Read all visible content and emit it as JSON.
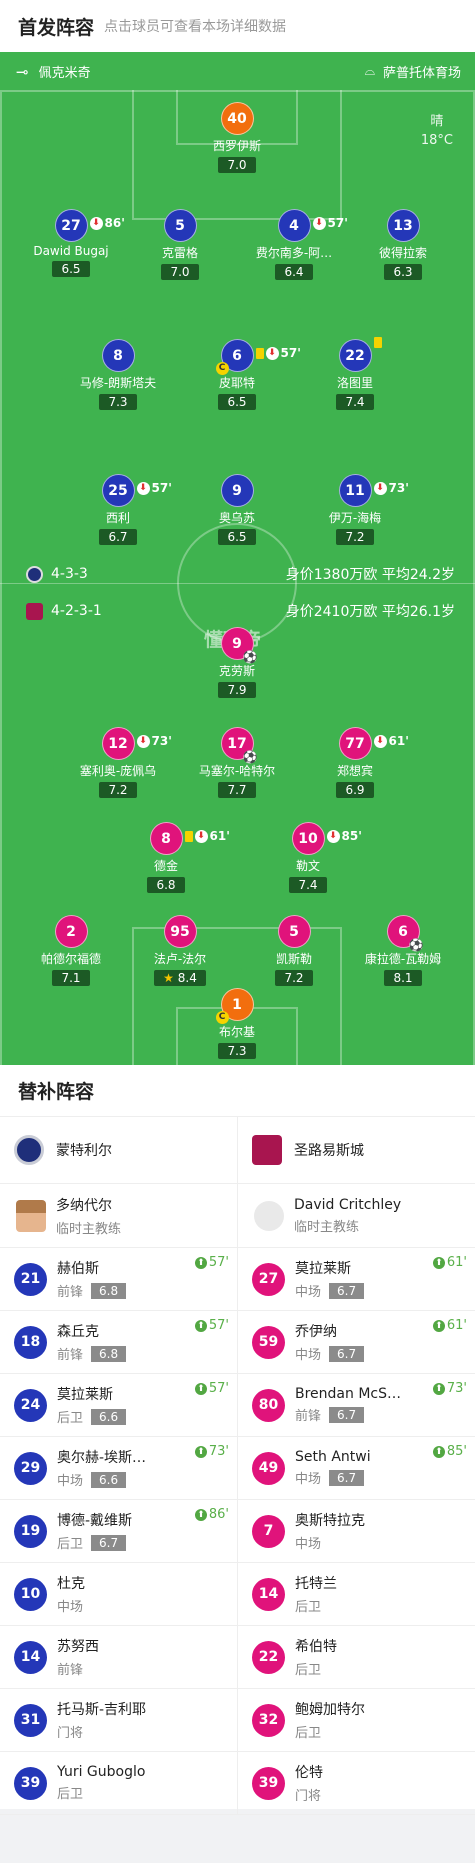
{
  "header": {
    "title": "首发阵容",
    "subtitle": "点击球员可查看本场详细数据"
  },
  "field": {
    "venue_left": "佩克米奇",
    "venue_right": "萨普托体育场",
    "weather": "晴",
    "temp": "18°C",
    "watermark": "懂球帝",
    "team_top": {
      "formation": "4-3-3",
      "value": "身价1380万欧 平均24.2岁"
    },
    "team_bottom": {
      "formation": "4-2-3-1",
      "value": "身价2410万欧 平均26.1岁"
    }
  },
  "top_players": [
    {
      "num": "40",
      "name": "西罗伊斯",
      "rating": "7.0"
    },
    {
      "num": "27",
      "name": "Dawid Bugaj",
      "rating": "6.5",
      "sub": "86'"
    },
    {
      "num": "5",
      "name": "克雷格",
      "rating": "7.0"
    },
    {
      "num": "4",
      "name": "费尔南多-阿…",
      "rating": "6.4",
      "sub": "57'"
    },
    {
      "num": "13",
      "name": "彼得拉索",
      "rating": "6.3"
    },
    {
      "num": "8",
      "name": "马修-朗斯塔夫",
      "rating": "7.3"
    },
    {
      "num": "6",
      "name": "皮耶特",
      "rating": "6.5",
      "sub": "57'"
    },
    {
      "num": "22",
      "name": "洛图里",
      "rating": "7.4"
    },
    {
      "num": "25",
      "name": "西利",
      "rating": "6.7",
      "sub": "57'"
    },
    {
      "num": "9",
      "name": "奥乌苏",
      "rating": "6.5"
    },
    {
      "num": "11",
      "name": "伊万-海梅",
      "rating": "7.2",
      "sub": "73'"
    }
  ],
  "bottom_players": [
    {
      "num": "9",
      "name": "克劳斯",
      "rating": "7.9"
    },
    {
      "num": "12",
      "name": "塞利奥-庞佩乌",
      "rating": "7.2",
      "sub": "73'"
    },
    {
      "num": "17",
      "name": "马塞尔-哈特尔",
      "rating": "7.7"
    },
    {
      "num": "77",
      "name": "郑想宾",
      "rating": "6.9",
      "sub": "61'"
    },
    {
      "num": "8",
      "name": "德金",
      "rating": "6.8",
      "sub": "61'"
    },
    {
      "num": "10",
      "name": "勒文",
      "rating": "7.4",
      "sub": "85'"
    },
    {
      "num": "2",
      "name": "帕德尔福德",
      "rating": "7.1"
    },
    {
      "num": "95",
      "name": "法卢-法尔",
      "rating": "8.4"
    },
    {
      "num": "5",
      "name": "凯斯勒",
      "rating": "7.2"
    },
    {
      "num": "6",
      "name": "康拉德-瓦勒姆",
      "rating": "8.1"
    },
    {
      "num": "1",
      "name": "布尔基",
      "rating": "7.3"
    }
  ],
  "subs": {
    "title": "替补阵容",
    "left": {
      "team": "蒙特利尔",
      "coach": {
        "name": "多纳代尔",
        "role": "临时主教练"
      },
      "players": [
        {
          "num": "21",
          "name": "赫伯斯",
          "pos": "前锋",
          "rating": "6.8",
          "in": "57'"
        },
        {
          "num": "18",
          "name": "森丘克",
          "pos": "前锋",
          "rating": "6.8",
          "in": "57'"
        },
        {
          "num": "24",
          "name": "莫拉莱斯",
          "pos": "后卫",
          "rating": "6.6",
          "in": "57'"
        },
        {
          "num": "29",
          "name": "奥尔赫-埃斯…",
          "pos": "中场",
          "rating": "6.6",
          "in": "73'"
        },
        {
          "num": "19",
          "name": "博德-戴维斯",
          "pos": "后卫",
          "rating": "6.7",
          "in": "86'"
        },
        {
          "num": "10",
          "name": "杜克",
          "pos": "中场"
        },
        {
          "num": "14",
          "name": "苏努西",
          "pos": "前锋"
        },
        {
          "num": "31",
          "name": "托马斯-吉利耶",
          "pos": "门将"
        },
        {
          "num": "39",
          "name": "Yuri Guboglo",
          "pos": "后卫"
        }
      ]
    },
    "right": {
      "team": "圣路易斯城",
      "coach": {
        "name": "David Critchley",
        "role": "临时主教练"
      },
      "players": [
        {
          "num": "27",
          "name": "莫拉莱斯",
          "pos": "中场",
          "rating": "6.7",
          "in": "61'"
        },
        {
          "num": "59",
          "name": "乔伊纳",
          "pos": "中场",
          "rating": "6.7",
          "in": "61'"
        },
        {
          "num": "80",
          "name": "Brendan McS…",
          "pos": "前锋",
          "rating": "6.7",
          "in": "73'"
        },
        {
          "num": "49",
          "name": "Seth Antwi",
          "pos": "中场",
          "rating": "6.7",
          "in": "85'"
        },
        {
          "num": "7",
          "name": "奥斯特拉克",
          "pos": "中场"
        },
        {
          "num": "14",
          "name": "托特兰",
          "pos": "后卫"
        },
        {
          "num": "22",
          "name": "希伯特",
          "pos": "后卫"
        },
        {
          "num": "32",
          "name": "鲍姆加特尔",
          "pos": "后卫"
        },
        {
          "num": "39",
          "name": "伦特",
          "pos": "门将"
        }
      ]
    }
  },
  "colors": {
    "field": "#3fb34f",
    "top_team": "#2437b8",
    "bottom_team": "#e0137b",
    "goalkeeper": "#f26e0e"
  }
}
